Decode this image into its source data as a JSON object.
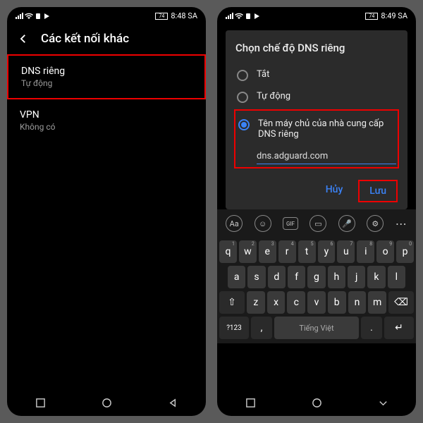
{
  "phone1": {
    "status": {
      "battery": "74",
      "time": "8:48 SA"
    },
    "header": "Các kết nối khác",
    "dns": {
      "title": "DNS riêng",
      "sub": "Tự động"
    },
    "vpn": {
      "title": "VPN",
      "sub": "Không có"
    }
  },
  "phone2": {
    "status": {
      "battery": "74",
      "time": "8:49 SA"
    },
    "dialog": {
      "title": "Chọn chế độ DNS riêng",
      "opt1": "Tắt",
      "opt2": "Tự động",
      "opt3": "Tên máy chủ của nhà cung cấp DNS riêng",
      "input": "dns.adguard.com",
      "cancel": "Hủy",
      "save": "Lưu"
    },
    "kb": {
      "gif": "GIF",
      "row1n": [
        "1",
        "2",
        "3",
        "4",
        "5",
        "6",
        "7",
        "8",
        "9",
        "0"
      ],
      "row1": [
        "q",
        "w",
        "e",
        "r",
        "t",
        "y",
        "u",
        "i",
        "o",
        "p"
      ],
      "row2": [
        "a",
        "s",
        "d",
        "f",
        "g",
        "h",
        "j",
        "k",
        "l"
      ],
      "row3": [
        "z",
        "x",
        "c",
        "v",
        "b",
        "n",
        "m"
      ],
      "sym": "?123",
      "lang": "Tiếng Việt"
    }
  }
}
